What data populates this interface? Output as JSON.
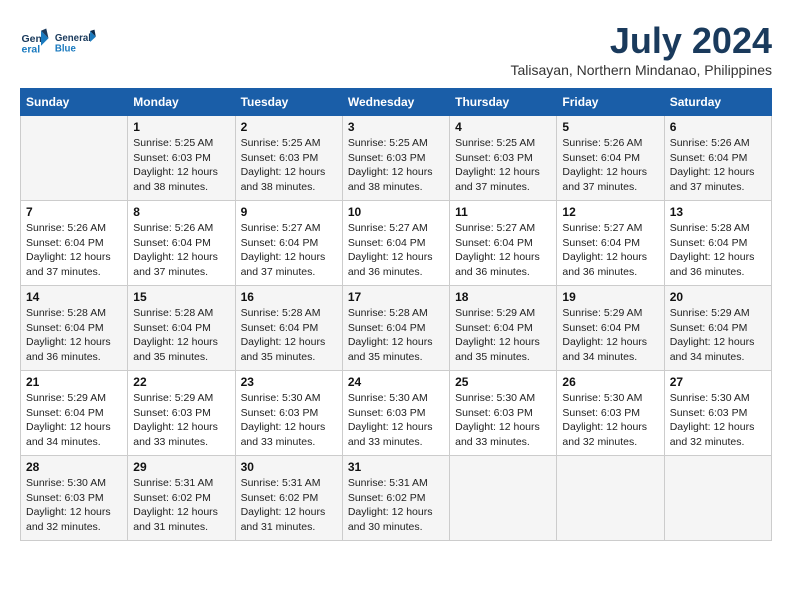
{
  "header": {
    "logo_line1": "General",
    "logo_line2": "Blue",
    "month_year": "July 2024",
    "location": "Talisayan, Northern Mindanao, Philippines"
  },
  "weekdays": [
    "Sunday",
    "Monday",
    "Tuesday",
    "Wednesday",
    "Thursday",
    "Friday",
    "Saturday"
  ],
  "weeks": [
    [
      {
        "day": "",
        "sunrise": "",
        "sunset": "",
        "daylight": ""
      },
      {
        "day": "1",
        "sunrise": "Sunrise: 5:25 AM",
        "sunset": "Sunset: 6:03 PM",
        "daylight": "Daylight: 12 hours and 38 minutes."
      },
      {
        "day": "2",
        "sunrise": "Sunrise: 5:25 AM",
        "sunset": "Sunset: 6:03 PM",
        "daylight": "Daylight: 12 hours and 38 minutes."
      },
      {
        "day": "3",
        "sunrise": "Sunrise: 5:25 AM",
        "sunset": "Sunset: 6:03 PM",
        "daylight": "Daylight: 12 hours and 38 minutes."
      },
      {
        "day": "4",
        "sunrise": "Sunrise: 5:25 AM",
        "sunset": "Sunset: 6:03 PM",
        "daylight": "Daylight: 12 hours and 37 minutes."
      },
      {
        "day": "5",
        "sunrise": "Sunrise: 5:26 AM",
        "sunset": "Sunset: 6:04 PM",
        "daylight": "Daylight: 12 hours and 37 minutes."
      },
      {
        "day": "6",
        "sunrise": "Sunrise: 5:26 AM",
        "sunset": "Sunset: 6:04 PM",
        "daylight": "Daylight: 12 hours and 37 minutes."
      }
    ],
    [
      {
        "day": "7",
        "sunrise": "Sunrise: 5:26 AM",
        "sunset": "Sunset: 6:04 PM",
        "daylight": "Daylight: 12 hours and 37 minutes."
      },
      {
        "day": "8",
        "sunrise": "Sunrise: 5:26 AM",
        "sunset": "Sunset: 6:04 PM",
        "daylight": "Daylight: 12 hours and 37 minutes."
      },
      {
        "day": "9",
        "sunrise": "Sunrise: 5:27 AM",
        "sunset": "Sunset: 6:04 PM",
        "daylight": "Daylight: 12 hours and 37 minutes."
      },
      {
        "day": "10",
        "sunrise": "Sunrise: 5:27 AM",
        "sunset": "Sunset: 6:04 PM",
        "daylight": "Daylight: 12 hours and 36 minutes."
      },
      {
        "day": "11",
        "sunrise": "Sunrise: 5:27 AM",
        "sunset": "Sunset: 6:04 PM",
        "daylight": "Daylight: 12 hours and 36 minutes."
      },
      {
        "day": "12",
        "sunrise": "Sunrise: 5:27 AM",
        "sunset": "Sunset: 6:04 PM",
        "daylight": "Daylight: 12 hours and 36 minutes."
      },
      {
        "day": "13",
        "sunrise": "Sunrise: 5:28 AM",
        "sunset": "Sunset: 6:04 PM",
        "daylight": "Daylight: 12 hours and 36 minutes."
      }
    ],
    [
      {
        "day": "14",
        "sunrise": "Sunrise: 5:28 AM",
        "sunset": "Sunset: 6:04 PM",
        "daylight": "Daylight: 12 hours and 36 minutes."
      },
      {
        "day": "15",
        "sunrise": "Sunrise: 5:28 AM",
        "sunset": "Sunset: 6:04 PM",
        "daylight": "Daylight: 12 hours and 35 minutes."
      },
      {
        "day": "16",
        "sunrise": "Sunrise: 5:28 AM",
        "sunset": "Sunset: 6:04 PM",
        "daylight": "Daylight: 12 hours and 35 minutes."
      },
      {
        "day": "17",
        "sunrise": "Sunrise: 5:28 AM",
        "sunset": "Sunset: 6:04 PM",
        "daylight": "Daylight: 12 hours and 35 minutes."
      },
      {
        "day": "18",
        "sunrise": "Sunrise: 5:29 AM",
        "sunset": "Sunset: 6:04 PM",
        "daylight": "Daylight: 12 hours and 35 minutes."
      },
      {
        "day": "19",
        "sunrise": "Sunrise: 5:29 AM",
        "sunset": "Sunset: 6:04 PM",
        "daylight": "Daylight: 12 hours and 34 minutes."
      },
      {
        "day": "20",
        "sunrise": "Sunrise: 5:29 AM",
        "sunset": "Sunset: 6:04 PM",
        "daylight": "Daylight: 12 hours and 34 minutes."
      }
    ],
    [
      {
        "day": "21",
        "sunrise": "Sunrise: 5:29 AM",
        "sunset": "Sunset: 6:04 PM",
        "daylight": "Daylight: 12 hours and 34 minutes."
      },
      {
        "day": "22",
        "sunrise": "Sunrise: 5:29 AM",
        "sunset": "Sunset: 6:03 PM",
        "daylight": "Daylight: 12 hours and 33 minutes."
      },
      {
        "day": "23",
        "sunrise": "Sunrise: 5:30 AM",
        "sunset": "Sunset: 6:03 PM",
        "daylight": "Daylight: 12 hours and 33 minutes."
      },
      {
        "day": "24",
        "sunrise": "Sunrise: 5:30 AM",
        "sunset": "Sunset: 6:03 PM",
        "daylight": "Daylight: 12 hours and 33 minutes."
      },
      {
        "day": "25",
        "sunrise": "Sunrise: 5:30 AM",
        "sunset": "Sunset: 6:03 PM",
        "daylight": "Daylight: 12 hours and 33 minutes."
      },
      {
        "day": "26",
        "sunrise": "Sunrise: 5:30 AM",
        "sunset": "Sunset: 6:03 PM",
        "daylight": "Daylight: 12 hours and 32 minutes."
      },
      {
        "day": "27",
        "sunrise": "Sunrise: 5:30 AM",
        "sunset": "Sunset: 6:03 PM",
        "daylight": "Daylight: 12 hours and 32 minutes."
      }
    ],
    [
      {
        "day": "28",
        "sunrise": "Sunrise: 5:30 AM",
        "sunset": "Sunset: 6:03 PM",
        "daylight": "Daylight: 12 hours and 32 minutes."
      },
      {
        "day": "29",
        "sunrise": "Sunrise: 5:31 AM",
        "sunset": "Sunset: 6:02 PM",
        "daylight": "Daylight: 12 hours and 31 minutes."
      },
      {
        "day": "30",
        "sunrise": "Sunrise: 5:31 AM",
        "sunset": "Sunset: 6:02 PM",
        "daylight": "Daylight: 12 hours and 31 minutes."
      },
      {
        "day": "31",
        "sunrise": "Sunrise: 5:31 AM",
        "sunset": "Sunset: 6:02 PM",
        "daylight": "Daylight: 12 hours and 30 minutes."
      },
      {
        "day": "",
        "sunrise": "",
        "sunset": "",
        "daylight": ""
      },
      {
        "day": "",
        "sunrise": "",
        "sunset": "",
        "daylight": ""
      },
      {
        "day": "",
        "sunrise": "",
        "sunset": "",
        "daylight": ""
      }
    ]
  ]
}
